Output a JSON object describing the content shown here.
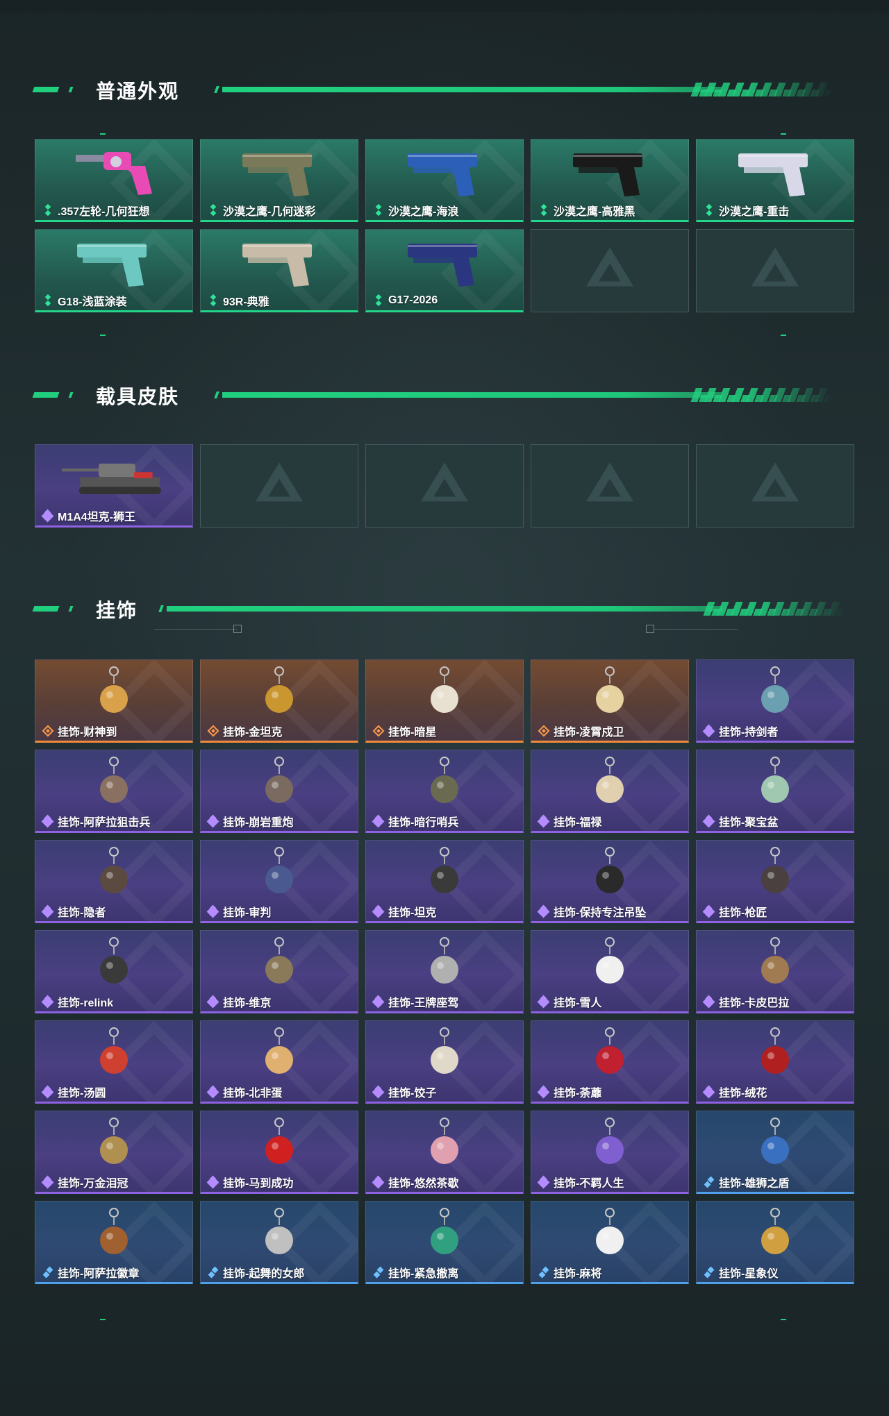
{
  "sections": [
    {
      "title": "普通外观",
      "items": [
        {
          "label": ".357左轮-几何狂想",
          "rarity": "green",
          "icon": "revolver-icon",
          "color": "#e84bb4"
        },
        {
          "label": "沙漠之鹰-几何迷彩",
          "rarity": "green",
          "icon": "pistol-icon",
          "color": "#7a7a5a"
        },
        {
          "label": "沙漠之鹰-海浪",
          "rarity": "green",
          "icon": "pistol-icon",
          "color": "#2b5fb8"
        },
        {
          "label": "沙漠之鹰-高雅黑",
          "rarity": "green",
          "icon": "pistol-icon",
          "color": "#1a1a1a"
        },
        {
          "label": "沙漠之鹰-重击",
          "rarity": "green",
          "icon": "pistol-icon",
          "color": "#d8d8e8"
        },
        {
          "label": "G18-浅蓝涂装",
          "rarity": "green",
          "icon": "pistol-icon",
          "color": "#6cc8c0"
        },
        {
          "label": "93R-典雅",
          "rarity": "green",
          "icon": "pistol-icon",
          "color": "#c8bca8"
        },
        {
          "label": "G17-2026",
          "rarity": "green",
          "icon": "pistol-icon",
          "color": "#2a3680"
        },
        {
          "label": "",
          "rarity": "empty"
        },
        {
          "label": "",
          "rarity": "empty"
        }
      ]
    },
    {
      "title": "载具皮肤",
      "items": [
        {
          "label": "M1A4坦克-狮王",
          "rarity": "purple",
          "icon": "tank-icon",
          "color": "#555555"
        },
        {
          "label": "",
          "rarity": "empty"
        },
        {
          "label": "",
          "rarity": "empty"
        },
        {
          "label": "",
          "rarity": "empty"
        },
        {
          "label": "",
          "rarity": "empty"
        }
      ]
    },
    {
      "title": "挂饰",
      "items": [
        {
          "label": "挂饰-财神到",
          "rarity": "orange",
          "icon": "charm-icon",
          "color": "#d9a24a"
        },
        {
          "label": "挂饰-金坦克",
          "rarity": "orange",
          "icon": "charm-icon",
          "color": "#c9962f"
        },
        {
          "label": "挂饰-暗星",
          "rarity": "orange",
          "icon": "charm-icon",
          "color": "#e8e0d0"
        },
        {
          "label": "挂饰-凌霄戍卫",
          "rarity": "orange",
          "icon": "charm-icon",
          "color": "#e6d2a0"
        },
        {
          "label": "挂饰-持剑者",
          "rarity": "purple",
          "icon": "charm-icon",
          "color": "#6aa0b0"
        },
        {
          "label": "挂饰-阿萨拉狙击兵",
          "rarity": "purple",
          "icon": "charm-icon",
          "color": "#8a7060"
        },
        {
          "label": "挂饰-崩岩重炮",
          "rarity": "purple",
          "icon": "charm-icon",
          "color": "#7a6a60"
        },
        {
          "label": "挂饰-暗行哨兵",
          "rarity": "purple",
          "icon": "charm-icon",
          "color": "#6a6a50"
        },
        {
          "label": "挂饰-福禄",
          "rarity": "purple",
          "icon": "charm-icon",
          "color": "#e0d0b0"
        },
        {
          "label": "挂饰-聚宝盆",
          "rarity": "purple",
          "icon": "charm-icon",
          "color": "#a0c8b0"
        },
        {
          "label": "挂饰-隐者",
          "rarity": "purple",
          "icon": "charm-icon",
          "color": "#5a4a40"
        },
        {
          "label": "挂饰-审判",
          "rarity": "purple",
          "icon": "charm-icon",
          "color": "#4a5a90"
        },
        {
          "label": "挂饰-坦克",
          "rarity": "purple",
          "icon": "charm-icon",
          "color": "#3a3a3a"
        },
        {
          "label": "挂饰-保持专注吊坠",
          "rarity": "purple",
          "icon": "charm-icon",
          "color": "#2a2a2a"
        },
        {
          "label": "挂饰-枪匠",
          "rarity": "purple",
          "icon": "charm-icon",
          "color": "#4a4040"
        },
        {
          "label": "挂饰-relink",
          "rarity": "purple",
          "icon": "charm-icon",
          "color": "#3a3a3a"
        },
        {
          "label": "挂饰-维京",
          "rarity": "purple",
          "icon": "charm-icon",
          "color": "#8a7a5a"
        },
        {
          "label": "挂饰-王牌座驾",
          "rarity": "purple",
          "icon": "charm-icon",
          "color": "#b0b0b0"
        },
        {
          "label": "挂饰-雪人",
          "rarity": "purple",
          "icon": "charm-icon",
          "color": "#f0f0f0"
        },
        {
          "label": "挂饰-卡皮巴拉",
          "rarity": "purple",
          "icon": "charm-icon",
          "color": "#a07a50"
        },
        {
          "label": "挂饰-汤圆",
          "rarity": "purple",
          "icon": "charm-icon",
          "color": "#d04030"
        },
        {
          "label": "挂饰-北非蛋",
          "rarity": "purple",
          "icon": "charm-icon",
          "color": "#e0b070"
        },
        {
          "label": "挂饰-饺子",
          "rarity": "purple",
          "icon": "charm-icon",
          "color": "#e0d8c8"
        },
        {
          "label": "挂饰-荼蘼",
          "rarity": "purple",
          "icon": "charm-icon",
          "color": "#c02030"
        },
        {
          "label": "挂饰-绒花",
          "rarity": "purple",
          "icon": "charm-icon",
          "color": "#b02020"
        },
        {
          "label": "挂饰-万金泪冠",
          "rarity": "purple",
          "icon": "charm-icon",
          "color": "#b09050"
        },
        {
          "label": "挂饰-马到成功",
          "rarity": "purple",
          "icon": "charm-icon",
          "color": "#d02020"
        },
        {
          "label": "挂饰-悠然茶歇",
          "rarity": "purple",
          "icon": "charm-icon",
          "color": "#e0a0b0"
        },
        {
          "label": "挂饰-不羁人生",
          "rarity": "purple",
          "icon": "charm-icon",
          "color": "#8060d0"
        },
        {
          "label": "挂饰-雄狮之盾",
          "rarity": "blue",
          "icon": "charm-icon",
          "color": "#3a70c0"
        },
        {
          "label": "挂饰-阿萨拉徽章",
          "rarity": "blue",
          "icon": "charm-icon",
          "color": "#a06030"
        },
        {
          "label": "挂饰-起舞的女郎",
          "rarity": "blue",
          "icon": "charm-icon",
          "color": "#c0c0c0"
        },
        {
          "label": "挂饰-紧急撤离",
          "rarity": "blue",
          "icon": "charm-icon",
          "color": "#30a080"
        },
        {
          "label": "挂饰-麻将",
          "rarity": "blue",
          "icon": "charm-icon",
          "color": "#f0f0f0"
        },
        {
          "label": "挂饰-星象仪",
          "rarity": "blue",
          "icon": "charm-icon",
          "color": "#d0a040"
        }
      ]
    }
  ],
  "colors": {
    "accent": "#21d07f",
    "green_border": "#23d68a",
    "purple_border": "#8e62e0",
    "orange_border": "#f28a3c",
    "blue_border": "#4f9fea"
  }
}
